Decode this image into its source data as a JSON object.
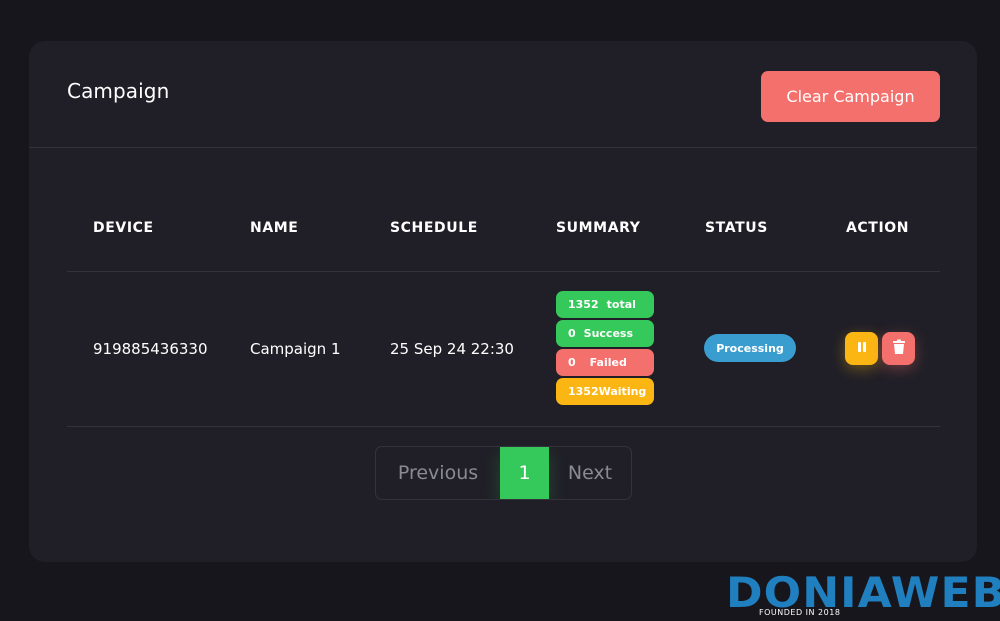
{
  "card": {
    "title": "Campaign",
    "clear_button": "Clear Campaign"
  },
  "table": {
    "headers": [
      "DEVICE",
      "NAME",
      "SCHEDULE",
      "SUMMARY",
      "STATUS",
      "ACTION"
    ],
    "rows": [
      {
        "device": "919885436330",
        "name": "Campaign 1",
        "schedule": "25 Sep 24 22:30",
        "summary": {
          "total_count": "1352",
          "total_label": "total",
          "success_count": "0",
          "success_label": "Success",
          "failed_count": "0",
          "failed_label": "Failed",
          "waiting_count": "1352",
          "waiting_label": "Waiting"
        },
        "status": "Processing",
        "actions": [
          "pause-icon",
          "trash-icon"
        ]
      }
    ]
  },
  "pagination": {
    "previous": "Previous",
    "current": "1",
    "next": "Next"
  },
  "watermark": {
    "brand": "DONIAWEB",
    "tagline": "FOUNDED IN 2018"
  },
  "colors": {
    "background": "#17161d",
    "card": "#201f27",
    "success": "#35c85a",
    "danger": "#f4706c",
    "warning": "#fbb613",
    "info": "#3a9dd0",
    "brand": "#1f7fbf"
  }
}
